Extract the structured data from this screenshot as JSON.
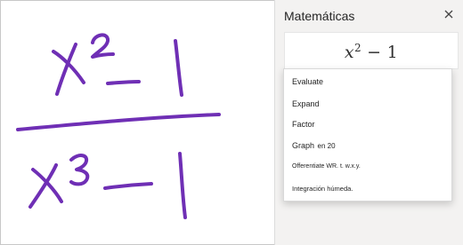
{
  "pane": {
    "title": "Matemáticas",
    "close_icon": "close-icon"
  },
  "preview": {
    "base": "x",
    "exponent": "2",
    "operator": "−",
    "constant": "1"
  },
  "handwriting": {
    "numerator": "x²−1",
    "denominator": "x³−1",
    "ink_color": "#6f2fb5"
  },
  "menu": {
    "items": [
      {
        "label": "Evaluate"
      },
      {
        "label": "Expand"
      },
      {
        "label": "Factor"
      },
      {
        "label": "Graph",
        "suffix": "en 20"
      },
      {
        "label": "Offerentiate WR. t. w.x.y."
      },
      {
        "label": "Integración húmeda."
      }
    ]
  },
  "colors": {
    "pane_background": "#f3f2f1",
    "accent": "#7a4fb0"
  }
}
